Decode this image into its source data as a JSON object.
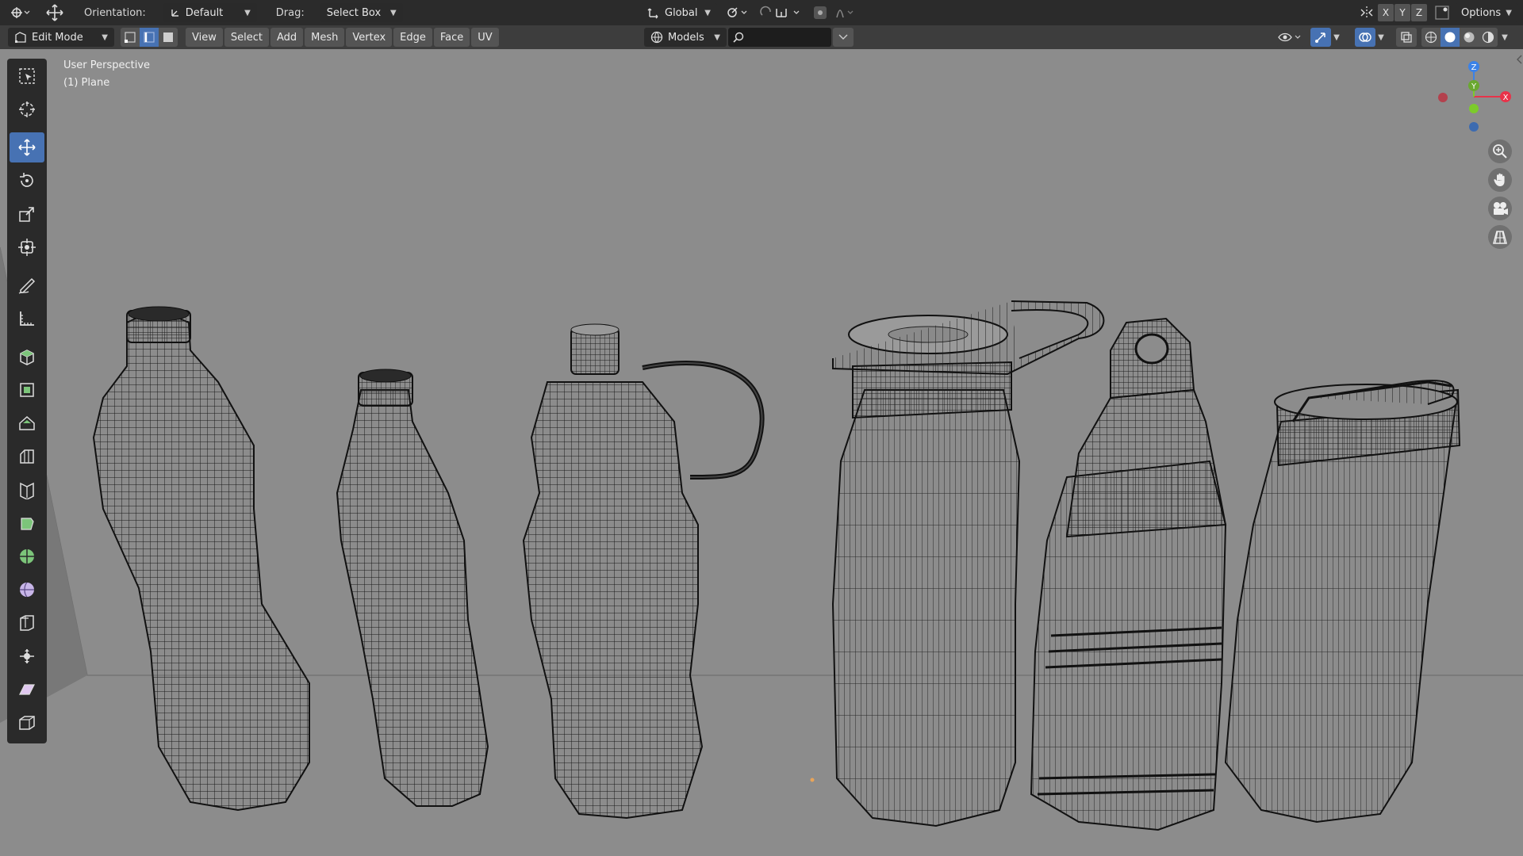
{
  "header": {
    "orientation_label": "Orientation:",
    "orientation_value": "Default",
    "drag_label": "Drag:",
    "drag_value": "Select Box",
    "transform_space": "Global",
    "axes": [
      "X",
      "Y",
      "Z"
    ],
    "options_label": "Options"
  },
  "editor": {
    "mode": "Edit Mode",
    "menus": [
      "View",
      "Select",
      "Add",
      "Mesh",
      "Vertex",
      "Edge",
      "Face",
      "UV"
    ],
    "select_modes": [
      "vertex-select",
      "edge-select",
      "face-select"
    ],
    "active_select_mode": "edge-select",
    "collection_filter": "Models",
    "search_placeholder": ""
  },
  "viewport": {
    "view_name": "User Perspective",
    "active_object": "(1) Plane",
    "background_color": "#8c8c8c",
    "wire_color": "#1a1a1a",
    "gizmo": {
      "x_color": "#e8334a",
      "y_color": "#7ccb2b",
      "z_color": "#3b82e8",
      "labels": [
        "Z",
        "Y",
        "X"
      ]
    },
    "objects": [
      "plastic-bottle-large",
      "plastic-bottle-slim",
      "sports-bottle-with-loop",
      "flask-with-handle-lid",
      "flask-with-ring-cap",
      "tumbler-with-flip-lid"
    ]
  },
  "toolbar": {
    "tools": [
      "select-box",
      "cursor",
      "move",
      "rotate",
      "scale",
      "transform",
      "annotate",
      "measure",
      "add-cube",
      "extrude",
      "inset",
      "bevel",
      "loop-cut",
      "knife",
      "poly-build",
      "spin",
      "smooth",
      "edge-slide",
      "shrink-fatten",
      "shear",
      "rip-region"
    ],
    "active_tool": "move"
  },
  "accent_color": "#4772b3"
}
